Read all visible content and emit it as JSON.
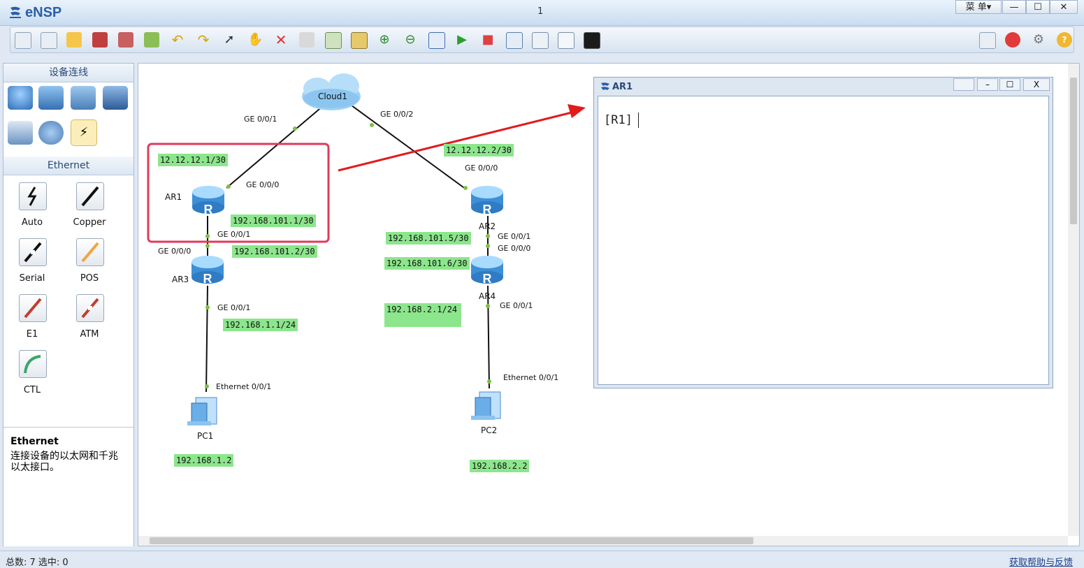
{
  "app": {
    "name": "eNSP",
    "window_title": "1",
    "menu_label": "菜 单▾",
    "minimize": "—",
    "maximize": "☐",
    "close": "✕"
  },
  "toolbar_icons": [
    "new-topology-icon",
    "new-wizard-icon",
    "open-icon",
    "save-icon",
    "save-as-icon",
    "print-icon",
    "undo-icon",
    "redo-icon",
    "select-icon",
    "hand-icon",
    "delete-icon",
    "delete-link-icon",
    "text-icon",
    "rectangle-icon",
    "zoom-in-icon",
    "zoom-out-icon",
    "fit-icon",
    "start-icon",
    "stop-icon",
    "capture-icon",
    "topology-icon",
    "grid-icon",
    "cli-icon"
  ],
  "left_panel": {
    "devices_header": "设备连线",
    "ethernet_header": "Ethernet",
    "cables": [
      {
        "label": "Auto"
      },
      {
        "label": "Copper"
      },
      {
        "label": "Serial"
      },
      {
        "label": "POS"
      },
      {
        "label": "E1"
      },
      {
        "label": "ATM"
      },
      {
        "label": "CTL"
      }
    ],
    "desc_title": "Ethernet",
    "desc_text": "连接设备的以太网和千兆以太接口。"
  },
  "topology": {
    "devices": [
      {
        "name": "Cloud1"
      },
      {
        "name": "AR1"
      },
      {
        "name": "AR2"
      },
      {
        "name": "AR3"
      },
      {
        "name": "AR4"
      },
      {
        "name": "PC1"
      },
      {
        "name": "PC2"
      }
    ],
    "ports": [
      "GE 0/0/1",
      "GE 0/0/2",
      "GE 0/0/0",
      "GE 0/0/1",
      "GE 0/0/0",
      "GE 0/0/0",
      "GE 0/0/1",
      "GE 0/0/0",
      "GE 0/0/1",
      "Ethernet 0/0/1",
      "GE 0/0/1",
      "Ethernet 0/0/1"
    ],
    "ips": [
      "12.12.12.1/30",
      "12.12.12.2/30",
      "192.168.101.1/30",
      "192.168.101.2/30",
      "192.168.101.5/30",
      "192.168.101.6/30",
      "192.168.1.1/24",
      "192.168.2.1/24",
      "192.168.1.2",
      "192.168.2.2"
    ]
  },
  "terminal": {
    "title": "AR1",
    "prompt": "[R1]",
    "close": "X"
  },
  "status": {
    "left": "总数: 7  选中: 0",
    "right": "获取帮助与反馈"
  },
  "colors": {
    "ip_label_bg": "#8ce68c",
    "highlight_red": "#e03a5a",
    "arrow_red": "#e21b1b"
  }
}
